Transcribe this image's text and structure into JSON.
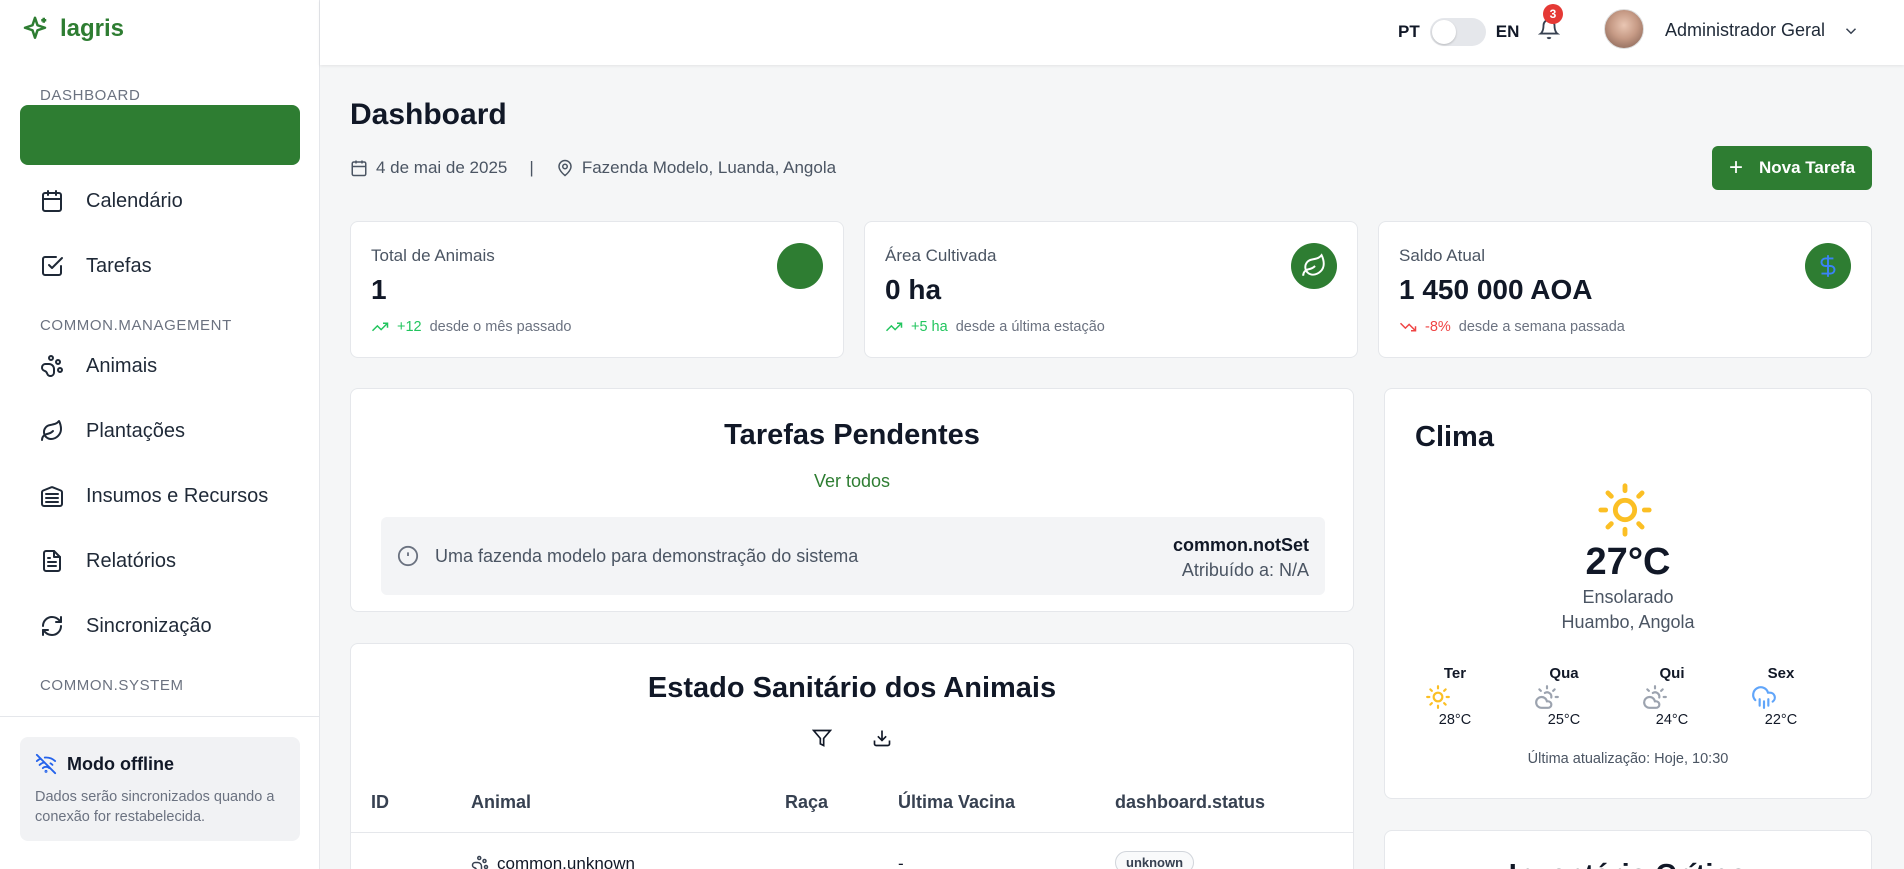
{
  "app": {
    "name": "lagris"
  },
  "sidebar": {
    "sections": {
      "dashboard": "DASHBOARD",
      "management": "COMMON.MANAGEMENT",
      "system": "COMMON.SYSTEM"
    },
    "items": [
      {
        "label": "Calendário",
        "icon": "calendar-icon"
      },
      {
        "label": "Tarefas",
        "icon": "check-square-icon"
      },
      {
        "label": "Animais",
        "icon": "paw-icon"
      },
      {
        "label": "Plantações",
        "icon": "leaf-icon"
      },
      {
        "label": "Insumos e Recursos",
        "icon": "warehouse-icon"
      },
      {
        "label": "Relatórios",
        "icon": "file-text-icon"
      },
      {
        "label": "Sincronização",
        "icon": "refresh-icon"
      }
    ],
    "offline": {
      "title": "Modo offline",
      "text": "Dados serão sincronizados quando a conexão for restabelecida."
    }
  },
  "header": {
    "lang_pt": "PT",
    "lang_en": "EN",
    "notification_count": "3",
    "user_name": "Administrador Geral"
  },
  "page": {
    "title": "Dashboard",
    "date": "4 de mai de 2025",
    "separator": "|",
    "location": "Fazenda Modelo, Luanda, Angola",
    "new_task_label": "Nova Tarefa"
  },
  "stats": [
    {
      "label": "Total de Animais",
      "value": "1",
      "trend": "+12",
      "trend_text": "desde o mês passado",
      "direction": "up"
    },
    {
      "label": "Área Cultivada",
      "value": "0 ha",
      "trend": "+5 ha",
      "trend_text": "desde a última estação",
      "direction": "up"
    },
    {
      "label": "Saldo Atual",
      "value": "1 450 000 AOA",
      "trend": "-8%",
      "trend_text": "desde a semana passada",
      "direction": "down"
    }
  ],
  "tasks": {
    "title": "Tarefas Pendentes",
    "see_all": "Ver todos",
    "items": [
      {
        "text": "Uma fazenda modelo para demonstração do sistema",
        "status": "common.notSet",
        "assignee": "Atribuído a: N/A"
      }
    ]
  },
  "health": {
    "title": "Estado Sanitário dos Animais",
    "columns": [
      "ID",
      "Animal",
      "Raça",
      "Última Vacina",
      "dashboard.status"
    ],
    "rows": [
      {
        "id": "",
        "animal": "common.unknown",
        "breed": "",
        "last_vaccine": "-",
        "status": "unknown"
      }
    ]
  },
  "weather": {
    "title": "Clima",
    "temperature": "27°C",
    "condition": "Ensolarado",
    "location": "Huambo, Angola",
    "forecast": [
      {
        "day": "Ter",
        "temp": "28°C",
        "icon": "sun-icon"
      },
      {
        "day": "Qua",
        "temp": "25°C",
        "icon": "cloud-sun-icon"
      },
      {
        "day": "Qui",
        "temp": "24°C",
        "icon": "cloud-sun-icon"
      },
      {
        "day": "Sex",
        "temp": "22°C",
        "icon": "cloud-rain-icon"
      }
    ],
    "updated": "Última atualização: Hoje, 10:30"
  },
  "next_card": {
    "title": "Inventário Crítico"
  },
  "colors": {
    "brand": "#2e7d32",
    "up": "#22c55e",
    "down": "#ef4444",
    "badge": "#e53935"
  }
}
